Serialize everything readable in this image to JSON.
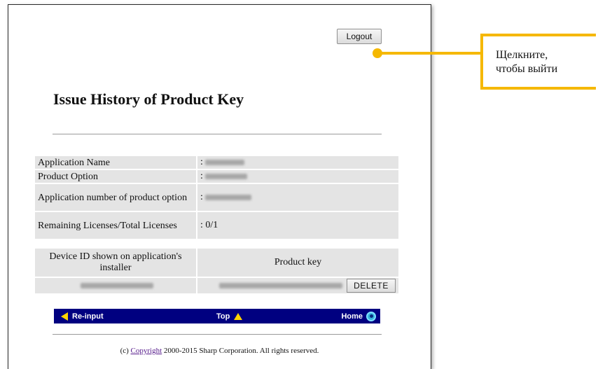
{
  "header": {
    "logout_label": "Logout"
  },
  "page_title": "Issue History of Product Key",
  "info_rows": [
    {
      "label": "Application Name",
      "value": ": "
    },
    {
      "label": "Product Option",
      "value": ": "
    },
    {
      "label": "Application number of product option",
      "value": ": "
    },
    {
      "label": "Remaining Licenses/Total Licenses",
      "value": ": 0/1"
    }
  ],
  "key_table": {
    "col_device": "Device ID shown on application's installer",
    "col_key": "Product key",
    "delete_label": "DELETE"
  },
  "nav": {
    "reinput": "Re-input",
    "top": "Top",
    "home": "Home"
  },
  "footer": {
    "prefix": "(c) ",
    "link": "Copyright",
    "suffix": " 2000-2015 Sharp Corporation. All rights reserved."
  },
  "callout": {
    "line1": "Щелкните,",
    "line2": "чтобы выйти"
  },
  "colors": {
    "nav_background": "#000080",
    "nav_arrow": "#ffd400",
    "callout": "#f5b800",
    "row_background": "#e4e4e4"
  }
}
